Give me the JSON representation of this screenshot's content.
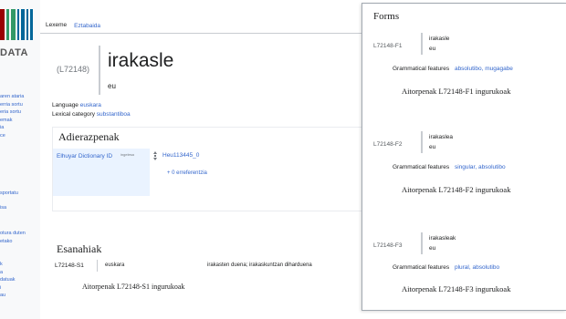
{
  "sidebar": {
    "logo_text": "DATA",
    "items_top": [
      "aren ataria",
      "",
      "erria sortu",
      "eria sortu",
      "emak",
      "ia",
      "ce"
    ],
    "items_mid": [
      "sportatu",
      "isa"
    ],
    "items_low": [
      "otura duten",
      "",
      "etako"
    ],
    "items_bottom": [
      "k",
      "a",
      "datuak",
      "i",
      "au"
    ]
  },
  "tabs": {
    "lexeme": "Lexeme",
    "discussion": "Eztabaida"
  },
  "lexeme": {
    "id": "(L72148)",
    "lemma": "irakasle",
    "lemma_language": "eu",
    "language_label": "Language",
    "language_value": "euskara",
    "category_label": "Lexical category",
    "category_value": "substantiboa"
  },
  "statements": {
    "title": "Adierazpenak",
    "property": "Elhuyar Dictionary ID",
    "property_lang": "ingelesa",
    "value": "Heu113445_0",
    "references": "+ 0 erreferentzia"
  },
  "senses": {
    "title": "Esanahiak",
    "sense_id": "L72148-S1",
    "gloss_language": "euskara",
    "gloss": "irakasten duena; irakaskuntzan diharduena",
    "claims_label": "Aitorpenak L72148-S1 ingurukoak"
  },
  "forms": {
    "title": "Forms",
    "items": [
      {
        "id": "L72148-F1",
        "representation": "irakasle",
        "language": "eu",
        "gf_label": "Grammatical features",
        "features": "absolutibo, mugagabe",
        "claims_label": "Aitorpenak L72148-F1 ingurukoak"
      },
      {
        "id": "L72148-F2",
        "representation": "irakaslea",
        "language": "eu",
        "gf_label": "Grammatical features",
        "features": "singular, absolutibo",
        "claims_label": "Aitorpenak L72148-F2 ingurukoak"
      },
      {
        "id": "L72148-F3",
        "representation": "irakasleak",
        "language": "eu",
        "gf_label": "Grammatical features",
        "features": "plural, absolutibo",
        "claims_label": "Aitorpenak L72148-F3 ingurukoak"
      }
    ]
  },
  "colors": {
    "link": "#3366cc",
    "logo_red": "#990000",
    "logo_green": "#339966",
    "logo_blue": "#006699",
    "rank_icon": "#72777d",
    "property_bg": "#eaf3ff"
  }
}
